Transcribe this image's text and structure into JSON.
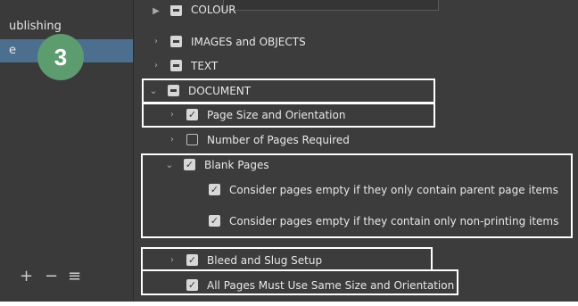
{
  "sidebar": {
    "items": [
      {
        "label": "ublishing"
      },
      {
        "label": "e"
      }
    ],
    "step_badge": "3",
    "toolbar": {
      "add": "+",
      "remove": "−",
      "menu": "≡"
    }
  },
  "tree": {
    "top_partial": {
      "label": "COLOUR"
    },
    "images": {
      "label": "IMAGES and OBJECTS"
    },
    "text": {
      "label": "TEXT"
    },
    "document": {
      "label": "DOCUMENT"
    },
    "page_size": {
      "label": "Page Size and Orientation",
      "checked": true
    },
    "num_pages": {
      "label": "Number of Pages Required",
      "checked": false
    },
    "blank_pages": {
      "label": "Blank Pages",
      "checked": true
    },
    "empty_parent": {
      "label": "Consider pages empty if they only contain parent page items",
      "checked": true
    },
    "empty_nonprint": {
      "label": "Consider pages empty if they contain only non-printing items",
      "checked": true
    },
    "bleed": {
      "label": "Bleed and Slug Setup",
      "checked": true
    },
    "same_size": {
      "label": "All Pages Must Use Same Size and Orientation",
      "checked": true
    }
  },
  "colors": {
    "background": "#3c3c3c",
    "selection": "#4d6f8f",
    "badge": "#5c9c6f",
    "highlight_outline": "#ffffff"
  },
  "icons": {
    "collapsed": "chevron-right-icon",
    "expanded": "chevron-down-icon",
    "check": "checkmark-icon"
  }
}
